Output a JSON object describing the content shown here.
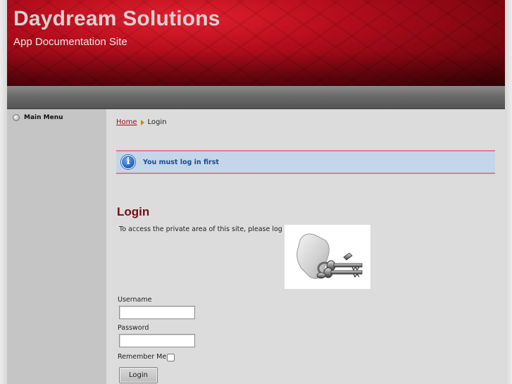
{
  "site": {
    "title": "Daydream Solutions",
    "subtitle": "App Documentation Site"
  },
  "sidebar": {
    "menu_title": "Main Menu"
  },
  "breadcrumb": {
    "home": "Home",
    "current": "Login"
  },
  "notice": {
    "message": "You must log in first",
    "icon": "info-icon"
  },
  "login": {
    "heading": "Login",
    "intro": "To access the private area of this site, please log in.",
    "image": "keys-image",
    "username_label": "Username",
    "username_value": "",
    "password_label": "Password",
    "password_value": "",
    "remember_label": "Remember Me",
    "remember_checked": false,
    "submit_label": "Login"
  },
  "colors": {
    "header_red": "#b50d1c",
    "heading_red": "#7a0a14",
    "notice_bg": "#c5d6ea",
    "notice_text": "#1a4c8f",
    "notice_border": "#e07e86"
  }
}
